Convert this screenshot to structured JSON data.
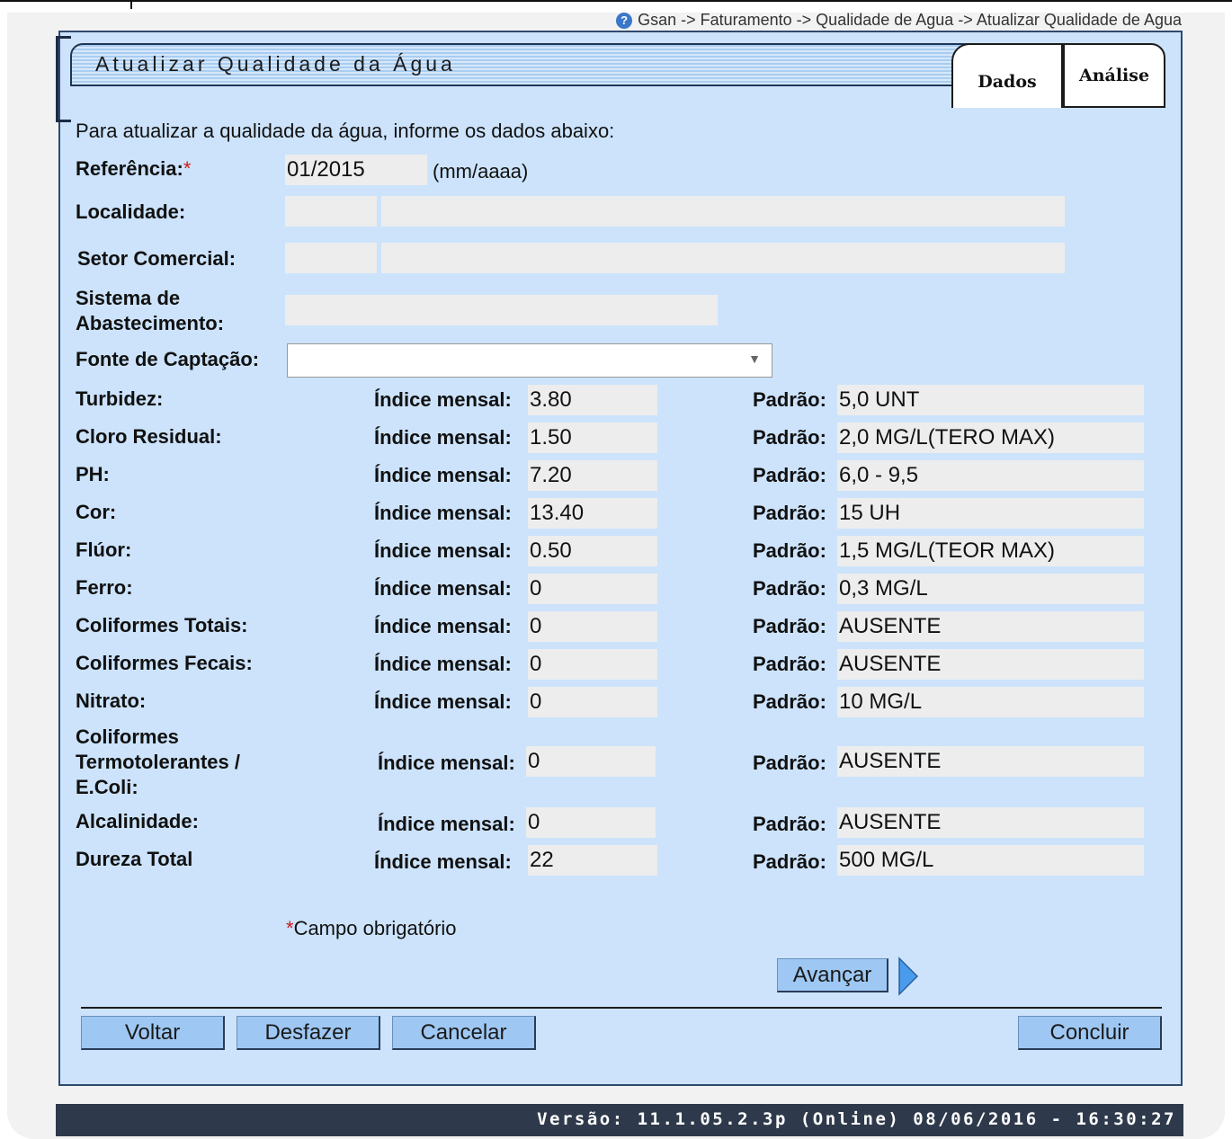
{
  "breadcrumb": {
    "text": "Gsan -> Faturamento -> Qualidade de Agua -> Atualizar Qualidade de Agua"
  },
  "header": {
    "title": "Atualizar Qualidade da Água"
  },
  "tabs": [
    {
      "label": "Dados"
    },
    {
      "label": "Análise"
    }
  ],
  "form": {
    "intro": "Para atualizar a qualidade da água, informe os dados abaixo:",
    "referencia_label": "Referência:",
    "referencia_value": "01/2015",
    "referencia_hint": "(mm/aaaa)",
    "localidade_label": "Localidade:",
    "setor_label": "Setor Comercial:",
    "sistema_label_1": "Sistema de",
    "sistema_label_2": "Abastecimento:",
    "fonte_label": "Fonte de Captação:",
    "required_mark": "*",
    "required_note": "Campo obrigatório"
  },
  "parameters": [
    {
      "name": "Turbidez:",
      "indice_label": "Índice mensal:",
      "indice": "3.80",
      "padrao_label": "Padrão:",
      "padrao": "5,0 UNT"
    },
    {
      "name": "Cloro Residual:",
      "indice_label": "Índice mensal:",
      "indice": "1.50",
      "padrao_label": "Padrão:",
      "padrao": "2,0 MG/L(TERO MAX)"
    },
    {
      "name": "PH:",
      "indice_label": "Índice mensal:",
      "indice": "7.20",
      "padrao_label": "Padrão:",
      "padrao": "6,0 - 9,5"
    },
    {
      "name": "Cor:",
      "indice_label": "Índice mensal:",
      "indice": "13.40",
      "padrao_label": "Padrão:",
      "padrao": "15 UH"
    },
    {
      "name": "Flúor:",
      "indice_label": "Índice mensal:",
      "indice": "0.50",
      "padrao_label": "Padrão:",
      "padrao": "1,5 MG/L(TEOR MAX)"
    },
    {
      "name": "Ferro:",
      "indice_label": "Índice mensal:",
      "indice": "0",
      "padrao_label": "Padrão:",
      "padrao": "0,3 MG/L"
    },
    {
      "name": "Coliformes Totais:",
      "indice_label": "Índice mensal:",
      "indice": "0",
      "padrao_label": "Padrão:",
      "padrao": "AUSENTE"
    },
    {
      "name": "Coliformes Fecais:",
      "indice_label": "Índice mensal:",
      "indice": "0",
      "padrao_label": "Padrão:",
      "padrao": "AUSENTE"
    },
    {
      "name": "Nitrato:",
      "indice_label": "Índice mensal:",
      "indice": "0",
      "padrao_label": "Padrão:",
      "padrao": "10 MG/L"
    },
    {
      "name_1": "Coliformes",
      "name_2": "Termotolerantes /",
      "name_3": "E.Coli:",
      "indice_label": "Índice mensal:",
      "indice": "0",
      "padrao_label": "Padrão:",
      "padrao": "AUSENTE"
    },
    {
      "name": "Alcalinidade:",
      "indice_label": "Índice mensal:",
      "indice": "0",
      "padrao_label": "Padrão:",
      "padrao": "AUSENTE"
    },
    {
      "name": "Dureza Total",
      "indice_label": "Índice mensal:",
      "indice": "22",
      "padrao_label": "Padrão:",
      "padrao": "500 MG/L"
    }
  ],
  "buttons": {
    "avancar": "Avançar",
    "voltar": "Voltar",
    "desfazer": "Desfazer",
    "cancelar": "Cancelar",
    "concluir": "Concluir"
  },
  "footer": {
    "version": "Versão: 11.1.05.2.3p (Online) 08/06/2016 - 16:30:27"
  },
  "icons": {
    "help": "help-icon",
    "select_arrow": "chevron-down-icon",
    "next": "arrow-right-icon"
  },
  "colors": {
    "panel": "#cce3fb",
    "button": "#9ec8f3",
    "footer": "#2e3a4b",
    "required": "#cc1a1a"
  }
}
